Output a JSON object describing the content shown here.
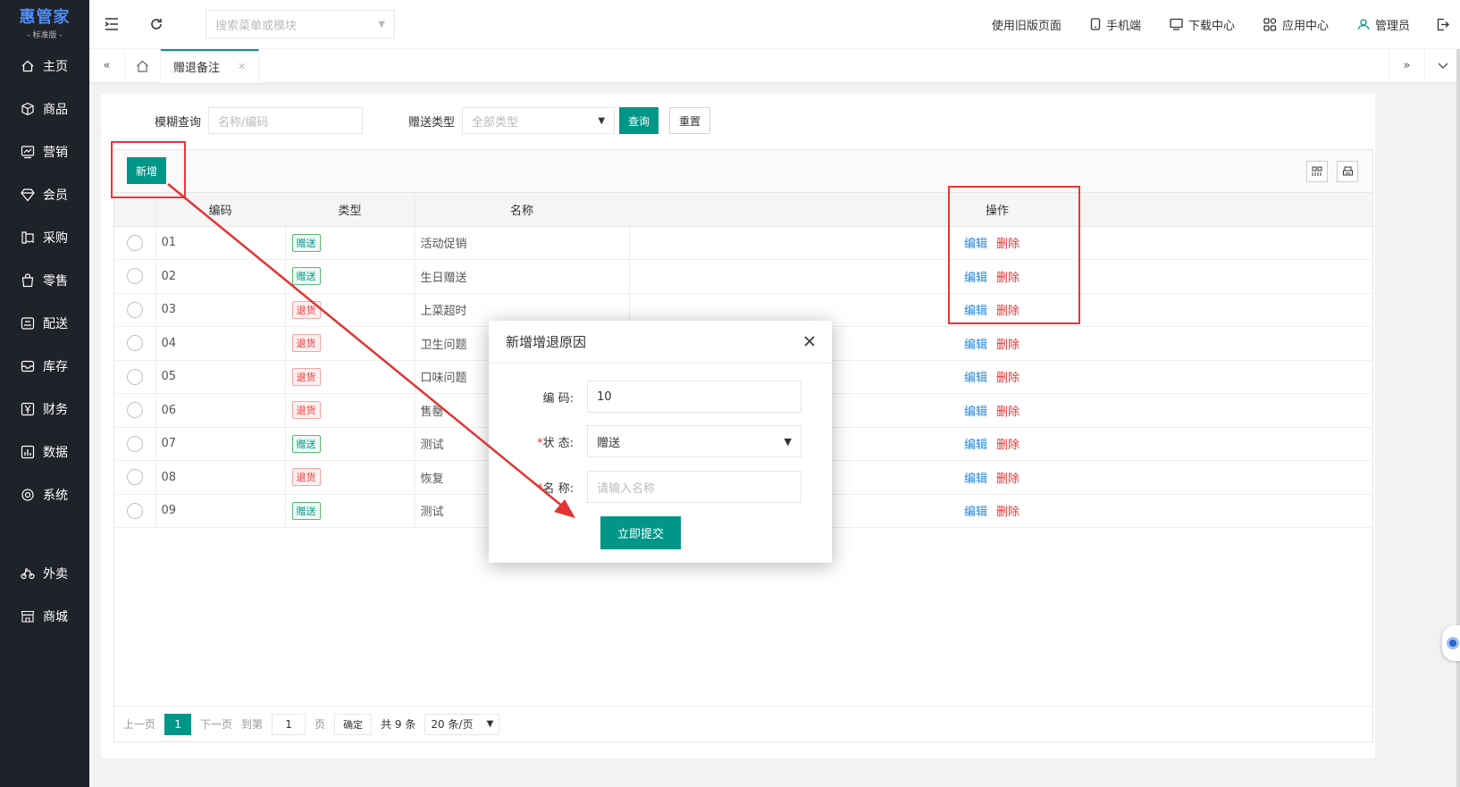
{
  "brand": {
    "name": "惠管家",
    "edition": "- 标准版 -"
  },
  "sidebar": {
    "items": [
      {
        "label": "主页",
        "icon": "home-icon"
      },
      {
        "label": "商品",
        "icon": "box-icon"
      },
      {
        "label": "营销",
        "icon": "chart-icon"
      },
      {
        "label": "会员",
        "icon": "diamond-icon"
      },
      {
        "label": "采购",
        "icon": "receipt-icon"
      },
      {
        "label": "零售",
        "icon": "bag-icon"
      },
      {
        "label": "配送",
        "icon": "delivery-icon"
      },
      {
        "label": "库存",
        "icon": "inbox-icon"
      },
      {
        "label": "财务",
        "icon": "yen-icon"
      },
      {
        "label": "数据",
        "icon": "bar-chart-icon"
      },
      {
        "label": "系统",
        "icon": "settings-icon"
      }
    ],
    "extra": [
      {
        "label": "外卖",
        "icon": "bike-icon"
      },
      {
        "label": "商城",
        "icon": "store-icon"
      }
    ]
  },
  "header": {
    "search_placeholder": "搜索菜单或模块",
    "links": {
      "old": "使用旧版页面",
      "mobile": "手机端",
      "download": "下载中心",
      "apps": "应用中心",
      "user": "管理员"
    }
  },
  "tabs": {
    "active": "赠退备注"
  },
  "filter": {
    "fuzzy_label": "模糊查询",
    "fuzzy_placeholder": "名称/编码",
    "type_label": "赠送类型",
    "type_value": "全部类型",
    "query": "查询",
    "reset": "重置"
  },
  "toolbar": {
    "add": "新增"
  },
  "table": {
    "headers": [
      "编码",
      "类型",
      "名称",
      "操作"
    ],
    "edit": "编辑",
    "delete": "删除",
    "rows": [
      {
        "code": "01",
        "type": "赠送",
        "name": "活动促销",
        "kind": "give"
      },
      {
        "code": "02",
        "type": "赠送",
        "name": "生日赠送",
        "kind": "give"
      },
      {
        "code": "03",
        "type": "退货",
        "name": "上菜超时",
        "kind": "ret"
      },
      {
        "code": "04",
        "type": "退货",
        "name": "卫生问题",
        "kind": "ret"
      },
      {
        "code": "05",
        "type": "退货",
        "name": "口味问题",
        "kind": "ret"
      },
      {
        "code": "06",
        "type": "退货",
        "name": "售罄",
        "kind": "ret"
      },
      {
        "code": "07",
        "type": "赠送",
        "name": "测试",
        "kind": "give"
      },
      {
        "code": "08",
        "type": "退货",
        "name": "恢复",
        "kind": "ret"
      },
      {
        "code": "09",
        "type": "赠送",
        "name": "测试",
        "kind": "give"
      }
    ]
  },
  "pager": {
    "prev": "上一页",
    "current": "1",
    "next": "下一页",
    "goto": "到第",
    "page_input": "1",
    "page_unit": "页",
    "confirm": "确定",
    "total": "共 9 条",
    "size": "20 条/页"
  },
  "modal": {
    "title": "新增增退原因",
    "code_label": "编 码:",
    "code_value": "10",
    "status_label": "状 态:",
    "status_value": "赠送",
    "name_label": "名 称:",
    "name_placeholder": "请输入名称",
    "submit": "立即提交"
  },
  "colors": {
    "primary": "#009688",
    "annotation": "#e33333",
    "sidebar": "#20222a"
  }
}
